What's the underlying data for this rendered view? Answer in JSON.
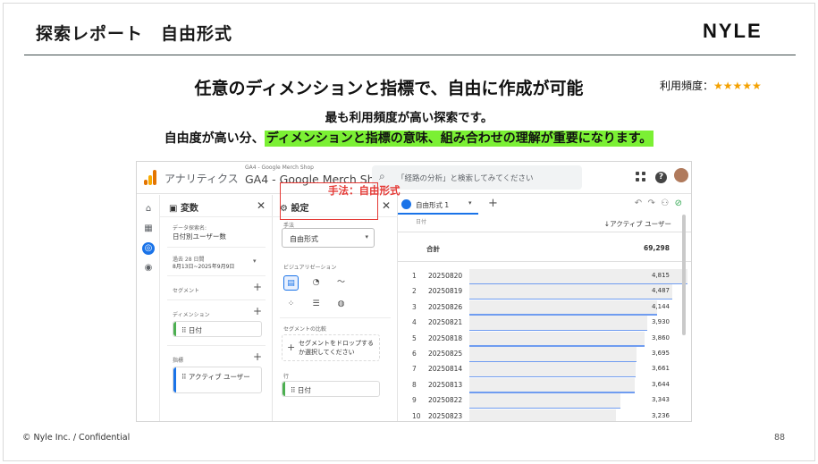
{
  "slide": {
    "title": "探索レポート　自由形式",
    "logo": "NYLE",
    "headline": "任意のディメンションと指標で、自由に作成が可能",
    "freq_label": "利用頻度：",
    "freq_stars": "★★★★★",
    "freq_rating": 5,
    "sub1": "最も利用頻度が高い探索です。",
    "sub2_prefix": "自由度が高い分、",
    "sub2_highlight": "ディメンションと指標の意味、組み合わせの理解が重要になります。",
    "footer_left": "© Nyle Inc. / Confidential",
    "footer_right": "88",
    "colors": {
      "highlight": "#7bf034",
      "star": "#f4a100",
      "annotation": "#e53935",
      "ga_blue": "#1a73e8"
    }
  },
  "screenshot": {
    "app_name": "アナリティクス",
    "account_small": "GA4 - Google Merch Shop",
    "account_big": "GA4 - Google Merch Shop",
    "search_placeholder": "「経路の分析」と検索してみてください",
    "icons": [
      "analytics-logo-icon",
      "search-icon",
      "apps-grid-icon",
      "help-icon",
      "avatar"
    ],
    "variables_panel": {
      "title": "変数",
      "data_name_label": "データ探索名:",
      "data_name_value": "日付別ユーザー数",
      "date_range_label": "過去 28 日間",
      "date_range_value": "8月13日~2025年9月9日",
      "segment_label": "セグメント",
      "dimension_label": "ディメンション",
      "dimension_item": "日付",
      "metric_label": "指標",
      "metric_item": "アクティブ ユーザー"
    },
    "settings_panel": {
      "title": "設定",
      "technique_label": "手法",
      "technique_value": "自由形式",
      "visualization_label": "ビジュアリゼーション",
      "segment_compare_label": "セグメントの比較",
      "segment_drop_text": "セグメントをドロップするか選択してください",
      "rows_label": "行",
      "rows_item": "日付"
    },
    "annotation": "手法：自由形式",
    "tab": {
      "label": "自由形式 1"
    },
    "table": {
      "col_dimension": "日付",
      "col_metric": "↓アクティブ ユーザー",
      "total_label": "合計",
      "total_value": "69,298",
      "rows": [
        {
          "n": "1",
          "date": "20250820",
          "value": "4,815",
          "v": 4815
        },
        {
          "n": "2",
          "date": "20250819",
          "value": "4,487",
          "v": 4487
        },
        {
          "n": "3",
          "date": "20250826",
          "value": "4,144",
          "v": 4144
        },
        {
          "n": "4",
          "date": "20250821",
          "value": "3,930",
          "v": 3930
        },
        {
          "n": "5",
          "date": "20250818",
          "value": "3,860",
          "v": 3860
        },
        {
          "n": "6",
          "date": "20250825",
          "value": "3,695",
          "v": 3695
        },
        {
          "n": "7",
          "date": "20250814",
          "value": "3,661",
          "v": 3661
        },
        {
          "n": "8",
          "date": "20250813",
          "value": "3,644",
          "v": 3644
        },
        {
          "n": "9",
          "date": "20250822",
          "value": "3,343",
          "v": 3343
        },
        {
          "n": "10",
          "date": "20250823",
          "value": "3,236",
          "v": 3236
        }
      ]
    }
  }
}
